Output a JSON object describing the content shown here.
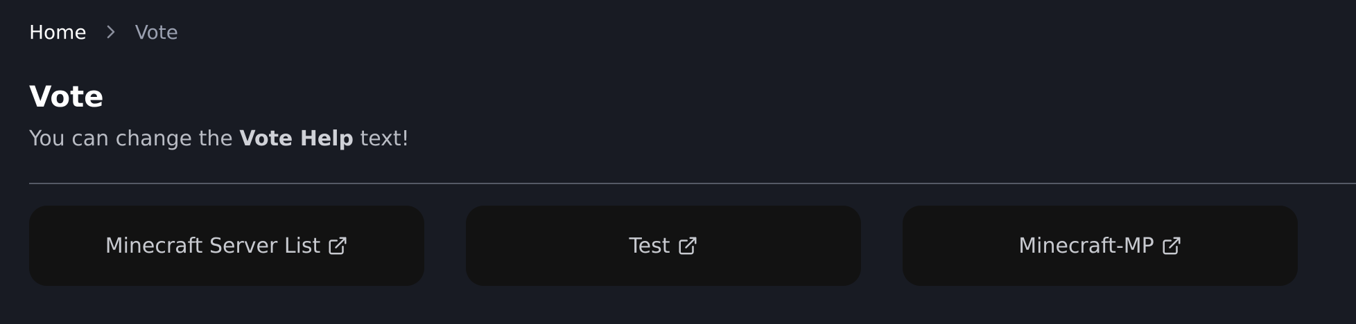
{
  "breadcrumb": {
    "home_label": "Home",
    "separator_icon": "chevron-right-icon",
    "current_label": "Vote"
  },
  "page": {
    "title": "Vote",
    "help_text_before": "You can change the ",
    "help_text_bold": "Vote Help",
    "help_text_after": " text!"
  },
  "vote_sites": [
    {
      "label": "Minecraft Server List",
      "icon": "external-link-icon"
    },
    {
      "label": "Test",
      "icon": "external-link-icon"
    },
    {
      "label": "Minecraft-MP",
      "icon": "external-link-icon"
    }
  ],
  "colors": {
    "background": "#181b23",
    "button_background": "#121212",
    "divider": "#555a66",
    "muted_text": "#9aa0b0"
  }
}
